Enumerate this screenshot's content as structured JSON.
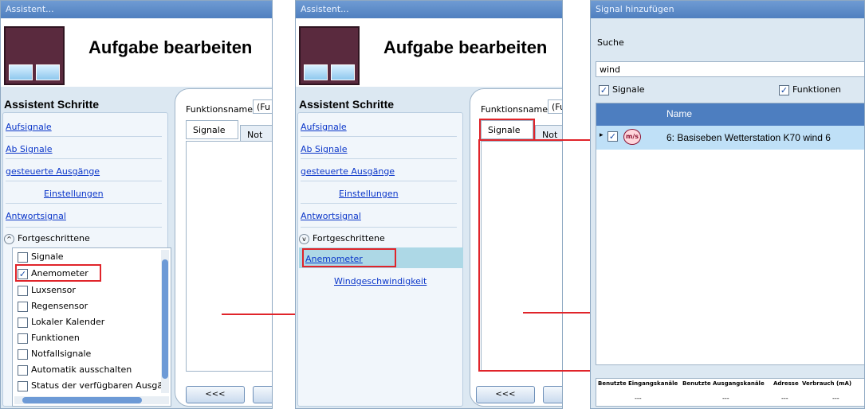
{
  "panel1": {
    "window_title": "Assistent...",
    "header_title": "Aufgabe bearbeiten",
    "steps_heading": "Assistent Schritte",
    "steps": [
      "Aufsignale",
      "Ab Signale",
      "gesteuerte Ausgänge",
      "Einstellungen",
      "Antwortsignal"
    ],
    "advanced_label": "Fortgeschrittene",
    "options": [
      {
        "label": "Signale",
        "checked": false
      },
      {
        "label": "Anemometer",
        "checked": true
      },
      {
        "label": "Luxsensor",
        "checked": false
      },
      {
        "label": "Regensensor",
        "checked": false
      },
      {
        "label": "Lokaler Kalender",
        "checked": false
      },
      {
        "label": "Funktionen",
        "checked": false
      },
      {
        "label": "Notfallsignale",
        "checked": false
      },
      {
        "label": "Automatik ausschalten",
        "checked": false
      },
      {
        "label": "Status der verfügbaren Ausgä",
        "checked": false
      }
    ],
    "function_name_label": "Funktionsname",
    "function_name_value": "(Fu",
    "tabs": [
      "Signale",
      "Not"
    ],
    "back_button": "<<<"
  },
  "panel2": {
    "window_title": "Assistent...",
    "header_title": "Aufgabe bearbeiten",
    "steps_heading": "Assistent Schritte",
    "steps": [
      "Aufsignale",
      "Ab Signale",
      "gesteuerte Ausgänge",
      "Einstellungen",
      "Antwortsignal"
    ],
    "advanced_label": "Fortgeschrittene",
    "sub_steps": [
      "Anemometer",
      "Windgeschwindigkeit"
    ],
    "function_name_label": "Funktionsname",
    "function_name_value": "(Fu",
    "tabs": [
      "Signale",
      "Not"
    ],
    "back_button": "<<<"
  },
  "panel3": {
    "window_title": "Signal hinzufügen",
    "search_label": "Suche",
    "search_value": "wind",
    "filter_signals": "Signale",
    "filter_functions": "Funktionen",
    "column_name": "Name",
    "row_icon": "m/s",
    "row_text": "6: Basiseben Wetterstation K70 wind 6",
    "footer_headers": [
      "Benutzte Eingangskanäle",
      "Benutzte Ausgangskanäle",
      "Adresse",
      "Verbrauch (mA)"
    ],
    "footer_values": [
      "---",
      "---",
      "---",
      "---"
    ]
  },
  "colors": {
    "accent": "#4d7ec0",
    "highlight_red": "#e0242a",
    "link": "#0b36c9"
  }
}
